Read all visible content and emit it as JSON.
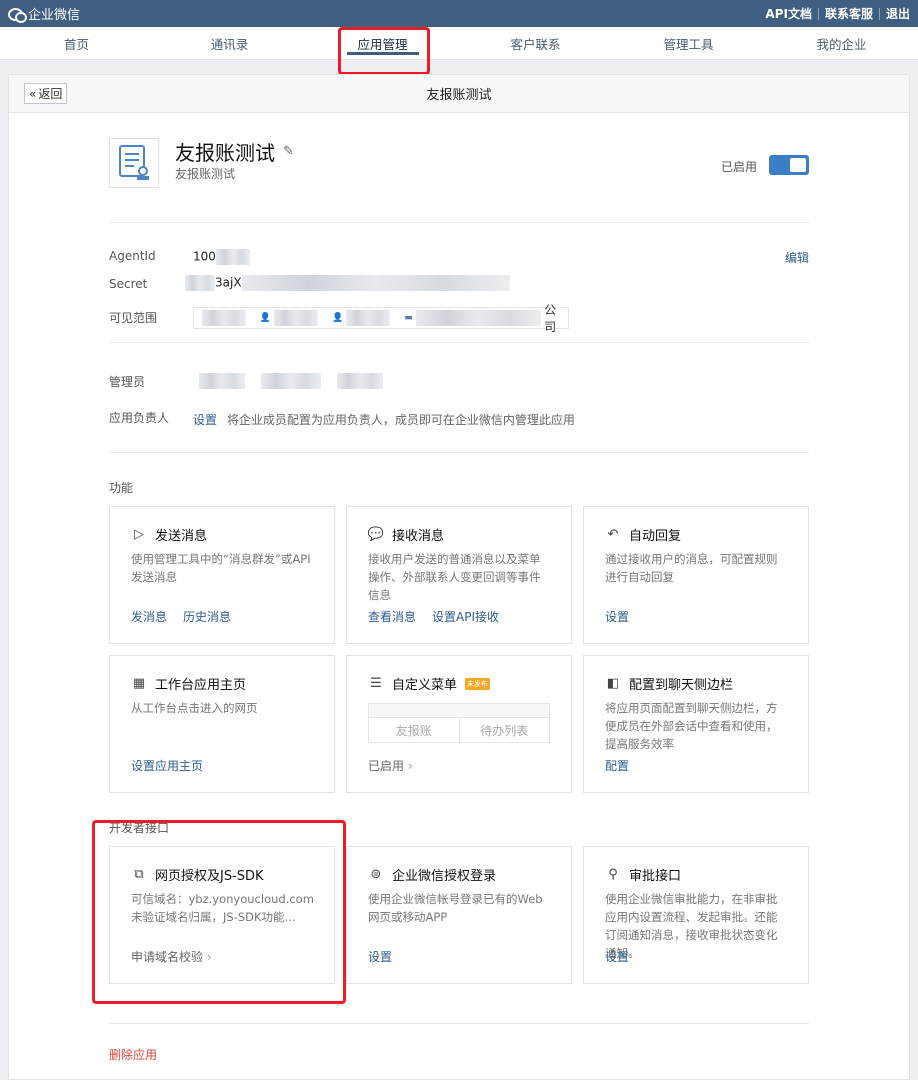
{
  "topbar": {
    "brand": "企业微信",
    "links": [
      "API文档",
      "联系客服",
      "退出"
    ]
  },
  "nav": [
    "首页",
    "通讯录",
    "应用管理",
    "客户联系",
    "管理工具",
    "我的企业"
  ],
  "subheader": {
    "back": "返回",
    "title": "友报账测试"
  },
  "app": {
    "name": "友报账测试",
    "subtitle": "友报账测试",
    "status": "已启用"
  },
  "info": {
    "agent_label": "AgentId",
    "agent_value": "100",
    "secret_label": "Secret",
    "secret_value": "3ajX",
    "scope_label": "可见范围",
    "scope_suffix": "公司",
    "edit": "编辑"
  },
  "admin": {
    "admin_label": "管理员",
    "owner_label": "应用负责人",
    "owner_action": "设置",
    "owner_desc": "将企业成员配置为应用负责人，成员即可在企业微信内管理此应用"
  },
  "features_title": "功能",
  "features": [
    {
      "title": "发送消息",
      "icon": "send-icon",
      "desc": "使用管理工具中的“消息群发”或API发送消息",
      "actions": [
        "发消息",
        "历史消息"
      ]
    },
    {
      "title": "接收消息",
      "icon": "chat-icon",
      "desc": "接收用户发送的普通消息以及菜单操作、外部联系人变更回调等事件信息",
      "actions": [
        "查看消息",
        "设置API接收"
      ]
    },
    {
      "title": "自动回复",
      "icon": "reply-icon",
      "desc": "通过接收用户的消息，可配置规则进行自动回复",
      "actions": [
        "设置"
      ]
    },
    {
      "title": "工作台应用主页",
      "icon": "grid-icon",
      "desc": "从工作台点击进入的网页",
      "actions": [
        "设置应用主页"
      ]
    },
    {
      "title": "自定义菜单",
      "icon": "menu-icon",
      "badge": "未发布",
      "menu_items": [
        "友报账",
        "待办列表"
      ],
      "status": "已启用"
    },
    {
      "title": "配置到聊天侧边栏",
      "icon": "sidebar-icon",
      "desc": "将应用页面配置到聊天侧边栏，方便成员在外部会话中查看和使用，提高服务效率",
      "actions": [
        "配置"
      ]
    }
  ],
  "dev_title": "开发者接口",
  "dev": [
    {
      "title": "网页授权及JS-SDK",
      "icon": "copy-icon",
      "desc": "可信域名：ybz.yonyoucloud.com 未验证域名归属，JS-SDK功能...",
      "action": "申请域名校验"
    },
    {
      "title": "企业微信授权登录",
      "icon": "login-icon",
      "desc": "使用企业微信帐号登录已有的Web网页或移动APP",
      "action": "设置"
    },
    {
      "title": "审批接口",
      "icon": "stamp-icon",
      "desc": "使用企业微信审批能力，在非审批应用内设置流程、发起审批。还能订阅通知消息，接收审批状态变化通知。",
      "action": "设置"
    }
  ],
  "delete": "删除应用"
}
